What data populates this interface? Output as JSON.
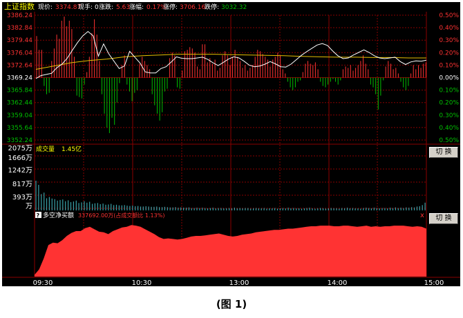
{
  "header": {
    "index_name": "上证指数",
    "items": [
      {
        "label": "现价:",
        "value": "3374.87"
      },
      {
        "label": "现手:",
        "value": "0"
      },
      {
        "label": "涨跌:",
        "value": "5.63"
      },
      {
        "label": "涨幅:",
        "value": "0.17%"
      },
      {
        "label": "涨停:",
        "value": "3706.16"
      },
      {
        "label": "跌停:",
        "value": "3032.32"
      }
    ]
  },
  "price_axis": {
    "left_labels": [
      "3386.24",
      "3382.84",
      "3379.44",
      "3376.04",
      "3372.64",
      "3369.24",
      "3365.84",
      "3362.44",
      "3359.04",
      "3355.64",
      "3352.24"
    ],
    "right_labels": [
      "0.50%",
      "0.40%",
      "0.30%",
      "0.20%",
      "0.10%",
      "0.00%",
      "0.10%",
      "0.20%",
      "0.30%",
      "0.40%",
      "0.50%"
    ]
  },
  "volume_panel": {
    "title": "成交量",
    "value": "1.45亿",
    "labels": [
      "2075万",
      "1666万",
      "1242万",
      "817万",
      "393万",
      "万"
    ],
    "button": "切 换"
  },
  "net_buy_panel": {
    "icon_label": "?",
    "title": "多空净买额",
    "value_text": "337692.00万(占成交额比 1.13%)",
    "close_icon": "x",
    "button": "切 换"
  },
  "time_axis": [
    "09:30",
    "10:30",
    "13:00",
    "14:00",
    "15:00"
  ],
  "caption": "(图 1)",
  "colors": {
    "background": "#000000",
    "grid": "#8b0000",
    "price_line": "#ffffff",
    "avg_line": "#e8c000",
    "up": "#ff3232",
    "down": "#00c000",
    "volume_bar": "#3aa0a8",
    "area": "#ff3333",
    "neutral_label": "#ffffff"
  },
  "chart_data": {
    "type": "line",
    "price": [
      3369.0,
      3369.8,
      3370.1,
      3370.4,
      3371.9,
      3372.9,
      3374.5,
      3376.7,
      3378.8,
      3380.6,
      3381.8,
      3380.6,
      3375.1,
      3378.4,
      3375.7,
      3373.7,
      3371.7,
      3372.4,
      3376.4,
      3374.8,
      3373.2,
      3370.8,
      3370.5,
      3370.5,
      3371.7,
      3372.2,
      3373.5,
      3374.9,
      3374.5,
      3374.4,
      3374.4,
      3374.6,
      3374.8,
      3374.2,
      3373.3,
      3372.5,
      3373.4,
      3374.3,
      3374.9,
      3374.6,
      3373.7,
      3372.6,
      3372.2,
      3372.4,
      3372.9,
      3373.6,
      3373.0,
      3372.2,
      3372.1,
      3372.9,
      3374.1,
      3375.3,
      3376.3,
      3377.2,
      3378.1,
      3378.5,
      3378.0,
      3376.5,
      3375.2,
      3374.4,
      3374.6,
      3375.4,
      3376.1,
      3376.8,
      3376.1,
      3375.2,
      3374.6,
      3374.4,
      3374.6,
      3374.8,
      3373.6,
      3372.8,
      3373.5,
      3373.8,
      3373.7,
      3374.0
    ],
    "avg": [
      3371.5,
      3372.4,
      3373.3,
      3373.9,
      3374.3,
      3374.9,
      3375.2,
      3375.4,
      3375.6,
      3375.6,
      3375.6,
      3375.5,
      3375.4,
      3375.3,
      3375.2,
      3375.0,
      3374.9,
      3374.8,
      3374.8,
      3374.7,
      3374.7,
      3374.6,
      3374.6
    ],
    "price_bars": [
      3.0,
      2.0,
      2.0,
      -0.6,
      -1.2,
      -1.1,
      1.2,
      2.1,
      3.1,
      2.8,
      4.1,
      4.4,
      3.7,
      4.1,
      3.5,
      1.5,
      -1.3,
      -1.4,
      -1.5,
      -0.5,
      0.4,
      1.5,
      3.2,
      4.2,
      3.1,
      1.2,
      -1.2,
      -2.6,
      -3.6,
      -4.0,
      -2.9,
      -3.4,
      -1.8,
      -0.4,
      0.9,
      1.6,
      -0.5,
      -1.0,
      -1.7,
      -1.1,
      -0.9,
      1.0,
      1.5,
      1.2,
      0.9,
      0.6,
      -1.2,
      -2.0,
      -2.6,
      -3.1,
      -2.5,
      -1.0,
      -0.8,
      1.4,
      1.8,
      1.6,
      -0.7,
      -0.8,
      0.5,
      1.9,
      2.0,
      2.2,
      2.1,
      1.8,
      0.8,
      0.6,
      2.4,
      2.4,
      1.1,
      1.4,
      1.0,
      1.3,
      0.5,
      0.7,
      1.6,
      1.9,
      1.6,
      0.9,
      1.5,
      2.0,
      1.5,
      1.2,
      0.7,
      0.9,
      0.5,
      0.7,
      0.9,
      1.5,
      2.0,
      1.9,
      1.7,
      1.5,
      1.3,
      0.8,
      1.3,
      1.5,
      1.8,
      1.6,
      0.6,
      0.3,
      -0.3,
      -0.7,
      -0.9,
      -0.7,
      -0.3,
      -0.2,
      0.4,
      1.0,
      1.2,
      1.0,
      0.9,
      1.1,
      0.6,
      -0.3,
      -0.6,
      -0.7,
      -0.5,
      -0.3,
      -0.1,
      -0.3,
      -0.5,
      -0.2,
      0.6,
      0.8,
      0.7,
      0.9,
      0.5,
      0.7,
      0.9,
      1.2,
      1.6,
      1.0,
      0.6,
      -0.5,
      -0.7,
      -1.2,
      -2.3,
      -1.3,
      -0.2,
      0.8,
      1.2,
      1.0,
      0.6,
      0.7,
      0.3,
      -0.3,
      -0.7,
      -0.9,
      -0.6,
      0.3,
      0.9,
      0.6,
      0.9,
      0.7,
      1.0,
      1.1
    ],
    "volume": [
      100,
      86,
      55,
      60,
      41,
      45,
      40,
      38,
      33,
      35,
      37,
      31,
      34,
      28,
      30,
      33,
      25,
      27,
      31,
      26,
      29,
      22,
      24,
      25,
      21,
      23,
      19,
      20,
      22,
      18,
      19,
      17,
      17,
      18,
      16,
      15,
      16,
      14,
      15,
      13,
      13,
      14,
      13,
      12,
      12,
      13,
      11,
      11,
      12,
      11,
      10,
      10,
      11,
      9,
      10,
      9,
      9,
      10,
      8,
      8,
      9,
      8,
      9,
      8,
      7,
      8,
      9,
      7,
      8,
      8,
      7,
      7,
      8,
      7,
      9,
      7,
      8,
      7,
      8,
      8,
      6,
      7,
      8,
      7,
      7,
      8,
      6,
      7,
      7,
      8,
      6,
      7,
      8,
      7,
      9,
      7,
      8,
      7,
      7,
      6,
      7,
      8,
      9,
      7,
      6,
      7,
      8,
      7,
      6,
      7,
      8,
      7,
      7,
      6,
      8,
      7,
      9,
      7,
      8,
      7,
      7,
      6,
      8,
      9,
      8,
      7,
      9,
      8,
      7,
      8,
      8,
      7,
      9,
      8,
      10,
      8,
      9,
      8,
      10,
      9,
      11,
      10,
      13,
      14,
      18,
      26
    ],
    "net_buy": [
      3,
      12,
      30,
      52,
      56,
      55,
      60,
      67,
      72,
      75,
      75,
      80,
      82,
      78,
      74,
      73,
      70,
      75,
      78,
      81,
      82,
      85,
      84,
      82,
      78,
      74,
      70,
      65,
      62,
      63,
      62,
      61,
      62,
      64,
      66,
      67,
      67,
      68,
      69,
      70,
      71,
      69,
      67,
      66,
      67,
      69,
      70,
      71,
      73,
      74,
      75,
      76,
      77,
      77,
      78,
      79,
      79,
      80,
      81,
      82,
      83,
      83,
      84,
      84,
      84,
      83,
      83,
      84,
      84,
      83,
      82,
      83,
      84,
      82,
      83,
      82,
      83,
      83,
      84,
      84,
      84,
      83,
      82,
      83,
      82,
      79
    ]
  }
}
